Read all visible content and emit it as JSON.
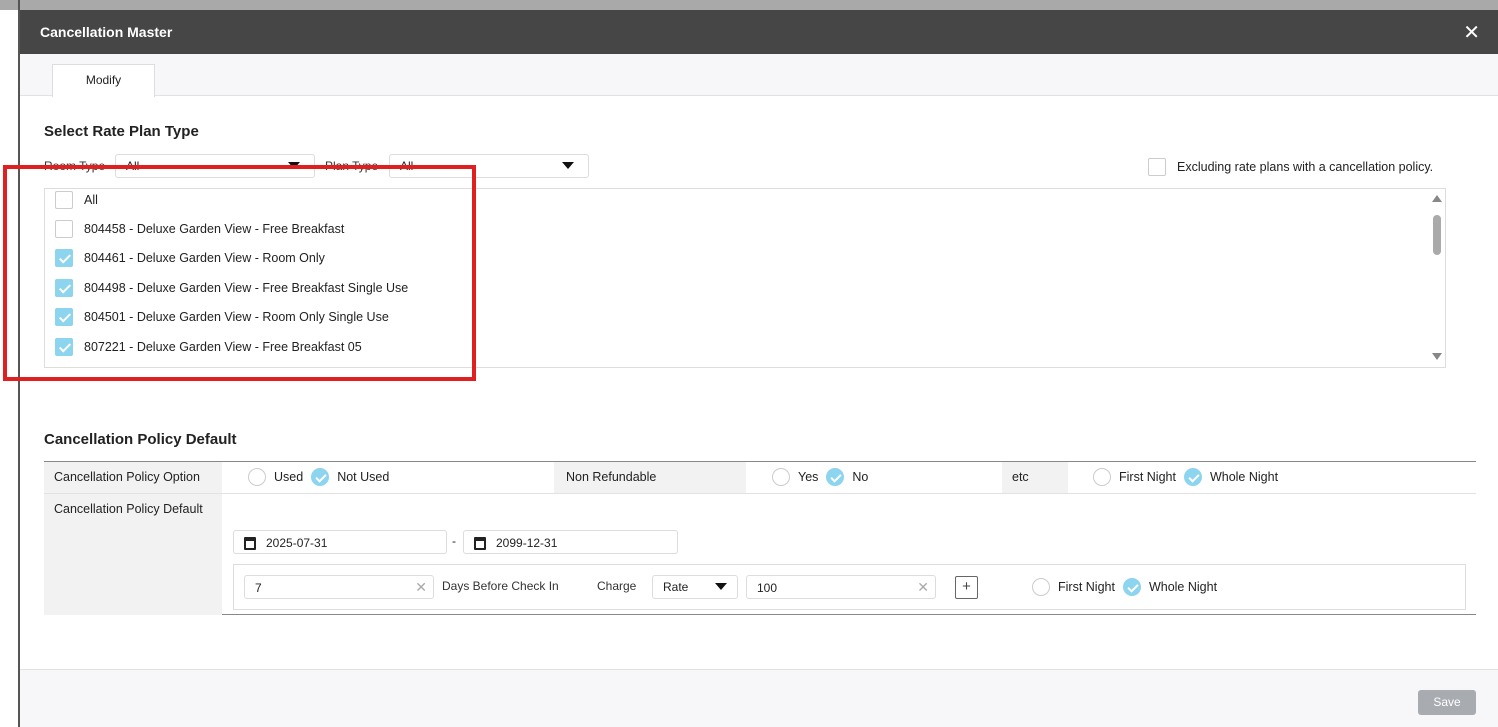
{
  "window": {
    "title": "Cancellation Master",
    "close": "✕"
  },
  "tabs": [
    {
      "label": "Modify"
    }
  ],
  "rate_plan": {
    "heading": "Select Rate Plan Type",
    "room_type_label": "Room Type",
    "room_type_value": "All",
    "plan_type_label": "Plan Type",
    "plan_type_value": "All",
    "exclude_label": "Excluding rate plans with a cancellation policy.",
    "items": [
      {
        "label": "All",
        "checked": false
      },
      {
        "label": "804458 - Deluxe Garden View - Free Breakfast",
        "checked": false
      },
      {
        "label": "804461 - Deluxe Garden View - Room Only",
        "checked": true
      },
      {
        "label": "804498 - Deluxe Garden View - Free Breakfast Single Use",
        "checked": true
      },
      {
        "label": "804501 - Deluxe Garden View - Room Only Single Use",
        "checked": true
      },
      {
        "label": "807221 - Deluxe Garden View - Free Breakfast 05",
        "checked": true
      }
    ]
  },
  "policy": {
    "heading": "Cancellation Policy Default",
    "option_label": "Cancellation Policy Option",
    "used": "Used",
    "not_used": "Not Used",
    "non_refundable": "Non Refundable",
    "yes": "Yes",
    "no": "No",
    "etc": "etc",
    "first_night": "First Night",
    "whole_night": "Whole Night",
    "default_label": "Cancellation Policy Default",
    "start_date": "2025-07-31",
    "end_date": "2099-12-31",
    "dash": "-",
    "days": "7",
    "days_label": "Days Before Check In",
    "charge_label": "Charge",
    "charge_type": "Rate",
    "charge_value": "100",
    "add": "+",
    "row_first_night": "First Night",
    "row_whole_night": "Whole Night"
  },
  "footer": {
    "save": "Save"
  },
  "colors": {
    "header": "#464646",
    "check": "#8dd4ee",
    "highlight": "#e02020"
  }
}
